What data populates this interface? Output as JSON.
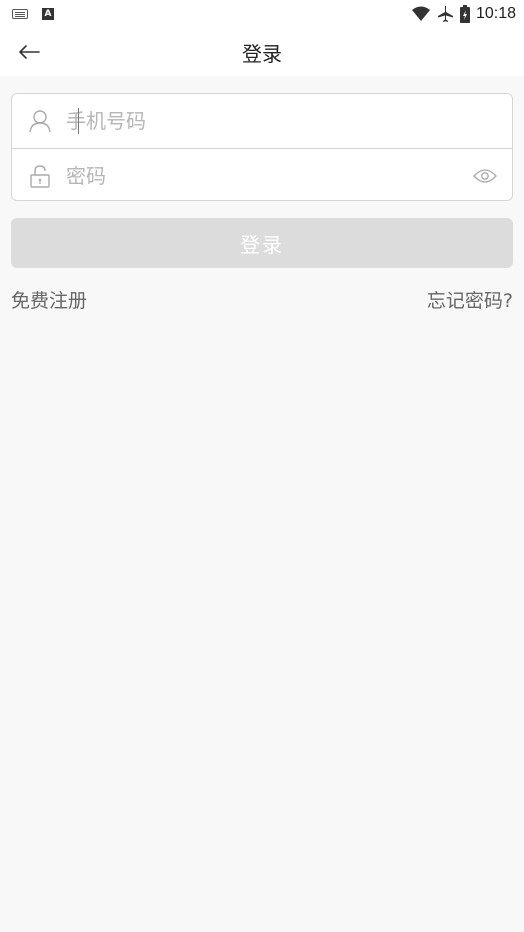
{
  "status_bar": {
    "left_icons": [
      "keyboard-icon",
      "a-notification-icon"
    ],
    "right_icons": [
      "wifi-icon",
      "airplane-icon",
      "battery-icon"
    ],
    "time": "10:18",
    "a_badge": "A"
  },
  "header": {
    "title": "登录",
    "back_icon": "back-arrow-icon"
  },
  "form": {
    "phone": {
      "placeholder": "手机号码",
      "value": "",
      "icon": "user-icon"
    },
    "password": {
      "placeholder": "密码",
      "value": "",
      "icon": "lock-icon",
      "toggle_icon": "eye-icon"
    }
  },
  "actions": {
    "login_label": "登录",
    "register_label": "免费注册",
    "forgot_label": "忘记密码?"
  },
  "colors": {
    "background": "#f8f8f8",
    "button_disabled": "#dcdcdc",
    "border": "#d6d6d6",
    "link_text": "#666666"
  }
}
